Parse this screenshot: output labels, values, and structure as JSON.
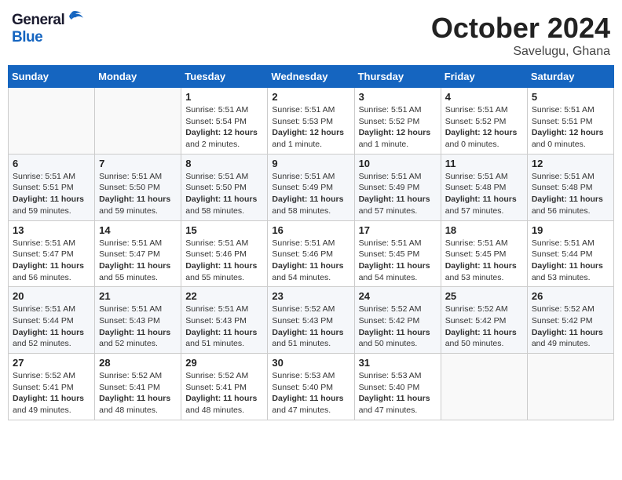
{
  "header": {
    "logo_general": "General",
    "logo_blue": "Blue",
    "month": "October 2024",
    "location": "Savelugu, Ghana"
  },
  "weekdays": [
    "Sunday",
    "Monday",
    "Tuesday",
    "Wednesday",
    "Thursday",
    "Friday",
    "Saturday"
  ],
  "weeks": [
    [
      {
        "day": "",
        "info": ""
      },
      {
        "day": "",
        "info": ""
      },
      {
        "day": "1",
        "info": "Sunrise: 5:51 AM\nSunset: 5:54 PM\nDaylight: 12 hours\nand 2 minutes."
      },
      {
        "day": "2",
        "info": "Sunrise: 5:51 AM\nSunset: 5:53 PM\nDaylight: 12 hours\nand 1 minute."
      },
      {
        "day": "3",
        "info": "Sunrise: 5:51 AM\nSunset: 5:52 PM\nDaylight: 12 hours\nand 1 minute."
      },
      {
        "day": "4",
        "info": "Sunrise: 5:51 AM\nSunset: 5:52 PM\nDaylight: 12 hours\nand 0 minutes."
      },
      {
        "day": "5",
        "info": "Sunrise: 5:51 AM\nSunset: 5:51 PM\nDaylight: 12 hours\nand 0 minutes."
      }
    ],
    [
      {
        "day": "6",
        "info": "Sunrise: 5:51 AM\nSunset: 5:51 PM\nDaylight: 11 hours\nand 59 minutes."
      },
      {
        "day": "7",
        "info": "Sunrise: 5:51 AM\nSunset: 5:50 PM\nDaylight: 11 hours\nand 59 minutes."
      },
      {
        "day": "8",
        "info": "Sunrise: 5:51 AM\nSunset: 5:50 PM\nDaylight: 11 hours\nand 58 minutes."
      },
      {
        "day": "9",
        "info": "Sunrise: 5:51 AM\nSunset: 5:49 PM\nDaylight: 11 hours\nand 58 minutes."
      },
      {
        "day": "10",
        "info": "Sunrise: 5:51 AM\nSunset: 5:49 PM\nDaylight: 11 hours\nand 57 minutes."
      },
      {
        "day": "11",
        "info": "Sunrise: 5:51 AM\nSunset: 5:48 PM\nDaylight: 11 hours\nand 57 minutes."
      },
      {
        "day": "12",
        "info": "Sunrise: 5:51 AM\nSunset: 5:48 PM\nDaylight: 11 hours\nand 56 minutes."
      }
    ],
    [
      {
        "day": "13",
        "info": "Sunrise: 5:51 AM\nSunset: 5:47 PM\nDaylight: 11 hours\nand 56 minutes."
      },
      {
        "day": "14",
        "info": "Sunrise: 5:51 AM\nSunset: 5:47 PM\nDaylight: 11 hours\nand 55 minutes."
      },
      {
        "day": "15",
        "info": "Sunrise: 5:51 AM\nSunset: 5:46 PM\nDaylight: 11 hours\nand 55 minutes."
      },
      {
        "day": "16",
        "info": "Sunrise: 5:51 AM\nSunset: 5:46 PM\nDaylight: 11 hours\nand 54 minutes."
      },
      {
        "day": "17",
        "info": "Sunrise: 5:51 AM\nSunset: 5:45 PM\nDaylight: 11 hours\nand 54 minutes."
      },
      {
        "day": "18",
        "info": "Sunrise: 5:51 AM\nSunset: 5:45 PM\nDaylight: 11 hours\nand 53 minutes."
      },
      {
        "day": "19",
        "info": "Sunrise: 5:51 AM\nSunset: 5:44 PM\nDaylight: 11 hours\nand 53 minutes."
      }
    ],
    [
      {
        "day": "20",
        "info": "Sunrise: 5:51 AM\nSunset: 5:44 PM\nDaylight: 11 hours\nand 52 minutes."
      },
      {
        "day": "21",
        "info": "Sunrise: 5:51 AM\nSunset: 5:43 PM\nDaylight: 11 hours\nand 52 minutes."
      },
      {
        "day": "22",
        "info": "Sunrise: 5:51 AM\nSunset: 5:43 PM\nDaylight: 11 hours\nand 51 minutes."
      },
      {
        "day": "23",
        "info": "Sunrise: 5:52 AM\nSunset: 5:43 PM\nDaylight: 11 hours\nand 51 minutes."
      },
      {
        "day": "24",
        "info": "Sunrise: 5:52 AM\nSunset: 5:42 PM\nDaylight: 11 hours\nand 50 minutes."
      },
      {
        "day": "25",
        "info": "Sunrise: 5:52 AM\nSunset: 5:42 PM\nDaylight: 11 hours\nand 50 minutes."
      },
      {
        "day": "26",
        "info": "Sunrise: 5:52 AM\nSunset: 5:42 PM\nDaylight: 11 hours\nand 49 minutes."
      }
    ],
    [
      {
        "day": "27",
        "info": "Sunrise: 5:52 AM\nSunset: 5:41 PM\nDaylight: 11 hours\nand 49 minutes."
      },
      {
        "day": "28",
        "info": "Sunrise: 5:52 AM\nSunset: 5:41 PM\nDaylight: 11 hours\nand 48 minutes."
      },
      {
        "day": "29",
        "info": "Sunrise: 5:52 AM\nSunset: 5:41 PM\nDaylight: 11 hours\nand 48 minutes."
      },
      {
        "day": "30",
        "info": "Sunrise: 5:53 AM\nSunset: 5:40 PM\nDaylight: 11 hours\nand 47 minutes."
      },
      {
        "day": "31",
        "info": "Sunrise: 5:53 AM\nSunset: 5:40 PM\nDaylight: 11 hours\nand 47 minutes."
      },
      {
        "day": "",
        "info": ""
      },
      {
        "day": "",
        "info": ""
      }
    ]
  ]
}
